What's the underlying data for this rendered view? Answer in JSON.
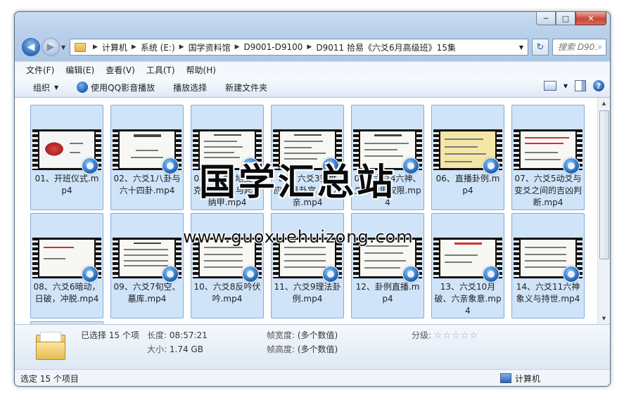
{
  "window": {
    "minimize_glyph": "─",
    "maximize_glyph": "□",
    "close_glyph": "✕"
  },
  "address_bar": {
    "breadcrumbs": [
      "计算机",
      "系统 (E:)",
      "国学资料馆",
      "D9001-D9100",
      "D9011 拾易《六爻6月高级班》15集"
    ],
    "separator": "▶",
    "refresh_glyph": "↻"
  },
  "search": {
    "placeholder": "搜索 D901...",
    "icon_glyph": "⌕"
  },
  "menu": [
    "文件(F)",
    "编辑(E)",
    "查看(V)",
    "工具(T)",
    "帮助(H)"
  ],
  "toolbar": {
    "organize": "组织",
    "play_with_qq": "使用QQ影音播放",
    "play_selection": "播放选择",
    "new_folder": "新建文件夹",
    "help_glyph": "?"
  },
  "files": [
    {
      "name": "01、开班仪式.mp4"
    },
    {
      "name": "02、六爻1八卦与六十四卦.mp4"
    },
    {
      "name": "03、六爻2地支生克冲合关系与起卦纳甲.mp4"
    },
    {
      "name": "04、六爻3安世应、寻卦宫、装六亲.mp4"
    },
    {
      "name": "05、六爻4六神、爻的作用权限.mp4"
    },
    {
      "name": "06、直播卦例.mp4"
    },
    {
      "name": "07、六爻5动爻与变爻之间的吉凶判断.mp4"
    },
    {
      "name": "08、六爻6暗动，日破，冲脱.mp4"
    },
    {
      "name": "09、六爻7旬空、墓库.mp4"
    },
    {
      "name": "10、六爻8反吟伏吟.mp4"
    },
    {
      "name": "11、六爻9理法卦例.mp4"
    },
    {
      "name": "12、卦例直播.mp4"
    },
    {
      "name": "13、六爻10月破、六亲象意.mp4"
    },
    {
      "name": "14、六爻11六神象义与持世.mp4"
    }
  ],
  "watermark": {
    "title": "国学汇总站",
    "url": "www.guoxuehuizong.com"
  },
  "details": {
    "selected": "已选择 15 个项",
    "length_label": "长度:",
    "length_value": "08:57:21",
    "size_label": "大小:",
    "size_value": "1.74 GB",
    "frame_width_label": "帧宽度:",
    "frame_width_value": "(多个数值)",
    "frame_height_label": "帧高度:",
    "frame_height_value": "(多个数值)",
    "rating_label": "分级:",
    "rating_stars": 0
  },
  "statusbar": {
    "left": "选定 15 个项目",
    "right": "计算机"
  }
}
